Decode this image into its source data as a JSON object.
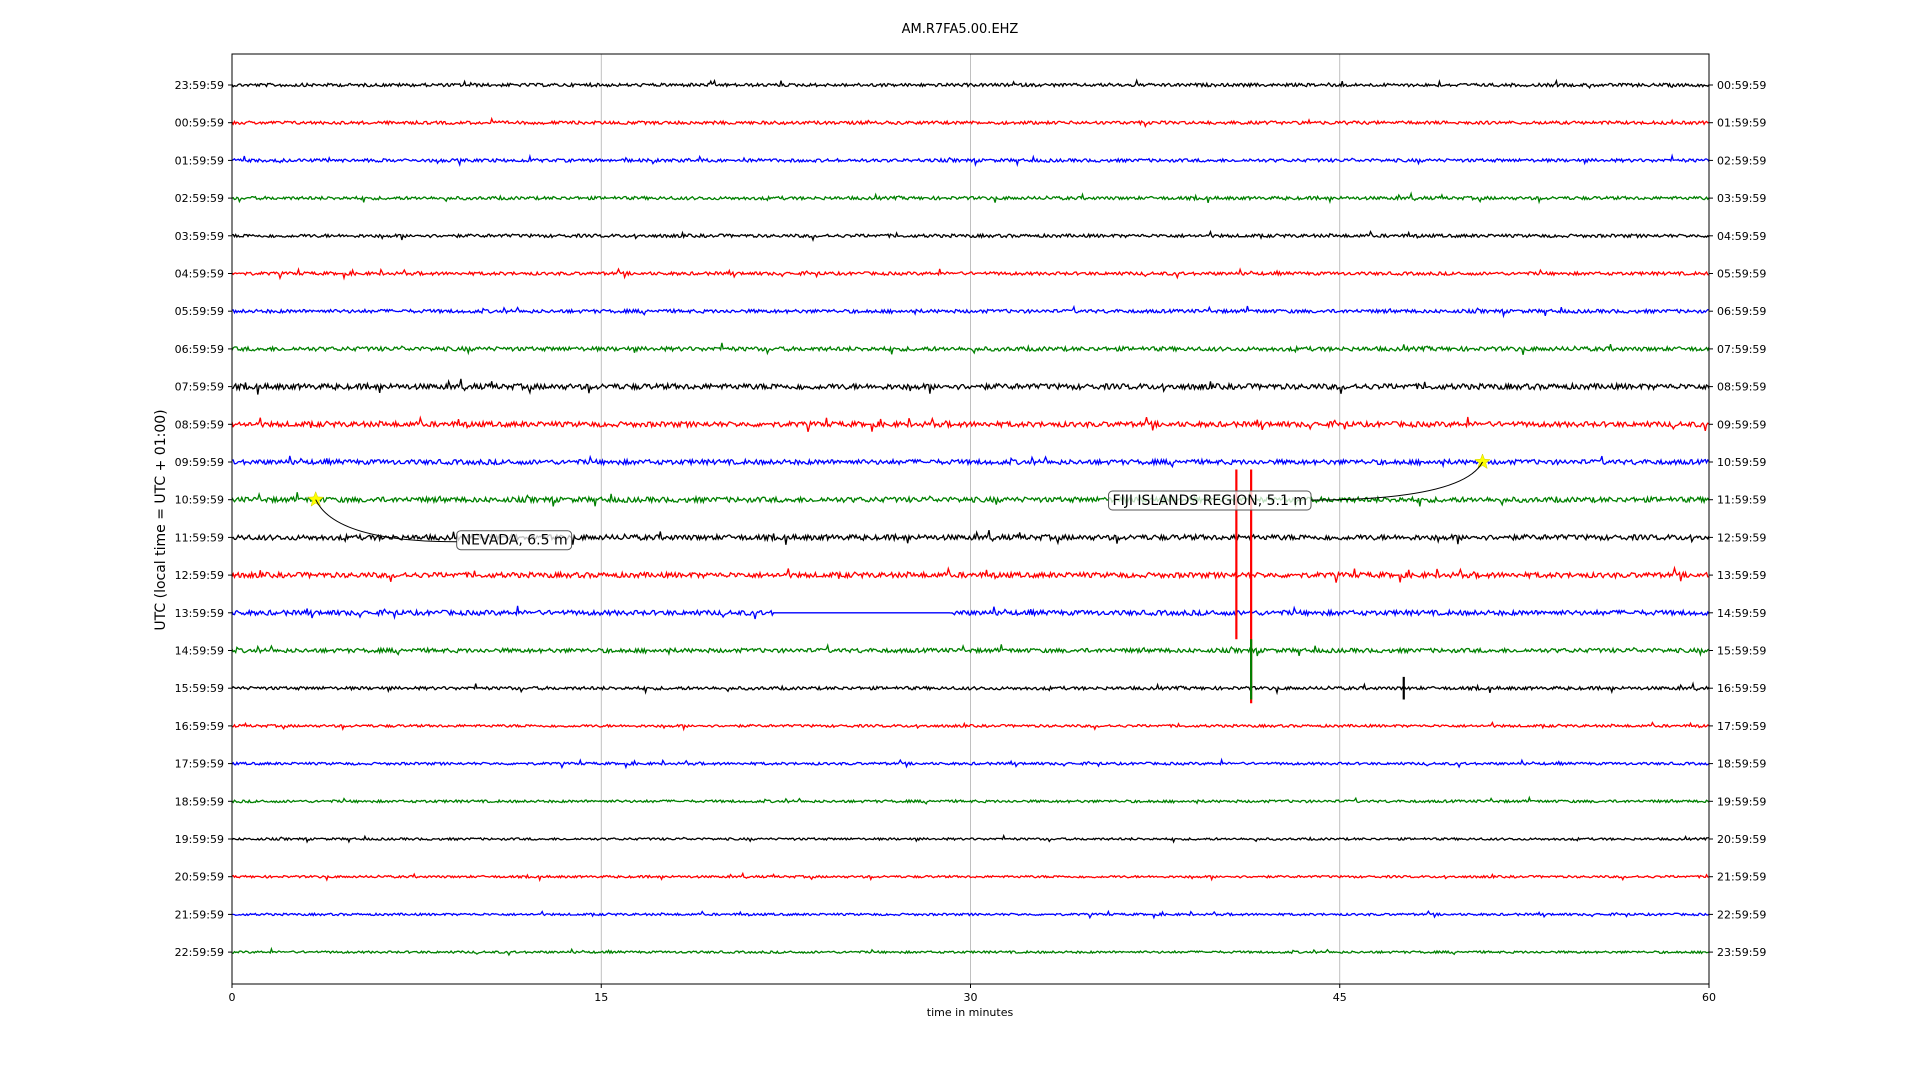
{
  "chart_data": {
    "type": "line",
    "title": "AM.R7FA5.00.EHZ",
    "xlabel": "time in minutes",
    "ylabel": "UTC (local time = UTC + 01:00)",
    "xlim": [
      0,
      60
    ],
    "xticks": [
      "0",
      "15",
      "30",
      "45",
      "60"
    ],
    "grid_x": true,
    "left_labels": [
      "23:59:59",
      "00:59:59",
      "01:59:59",
      "02:59:59",
      "03:59:59",
      "04:59:59",
      "05:59:59",
      "06:59:59",
      "07:59:59",
      "08:59:59",
      "09:59:59",
      "10:59:59",
      "11:59:59",
      "12:59:59",
      "13:59:59",
      "14:59:59",
      "15:59:59",
      "16:59:59",
      "17:59:59",
      "18:59:59",
      "19:59:59",
      "20:59:59",
      "21:59:59",
      "22:59:59"
    ],
    "right_labels": [
      "00:59:59",
      "01:59:59",
      "02:59:59",
      "03:59:59",
      "04:59:59",
      "05:59:59",
      "06:59:59",
      "07:59:59",
      "08:59:59",
      "09:59:59",
      "10:59:59",
      "11:59:59",
      "12:59:59",
      "13:59:59",
      "14:59:59",
      "15:59:59",
      "16:59:59",
      "17:59:59",
      "18:59:59",
      "19:59:59",
      "20:59:59",
      "21:59:59",
      "22:59:59",
      "23:59:59"
    ],
    "trace_colors": [
      "#000000",
      "#ff0000",
      "#0000ff",
      "#008000"
    ],
    "trace_amplitude": [
      1.0,
      1.0,
      1.0,
      1.0,
      1.0,
      1.0,
      1.1,
      1.3,
      1.7,
      1.6,
      1.5,
      1.6,
      1.6,
      1.6,
      1.5,
      1.3,
      1.0,
      0.8,
      0.8,
      0.8,
      0.7,
      0.7,
      0.7,
      0.7
    ],
    "gap": {
      "row": 14,
      "start_min": 22.0,
      "end_min": 29.2
    },
    "spikes": [
      {
        "row": 13,
        "minute": 40.8,
        "up": 2.8,
        "down": 1.7
      },
      {
        "row": 13,
        "minute": 41.4,
        "up": 2.8,
        "down": 3.4
      },
      {
        "row": 15,
        "minute": 41.4,
        "up": 0.3,
        "down": 1.3
      },
      {
        "row": 16,
        "minute": 47.6,
        "up": 0.3,
        "down": 0.3
      }
    ],
    "events": [
      {
        "row": 11,
        "minute": 3.4,
        "label": "NEVADA, 6.5 m"
      },
      {
        "row": 10,
        "minute": 50.8,
        "label": "FIJI ISLANDS REGION, 5.1 m"
      }
    ]
  }
}
